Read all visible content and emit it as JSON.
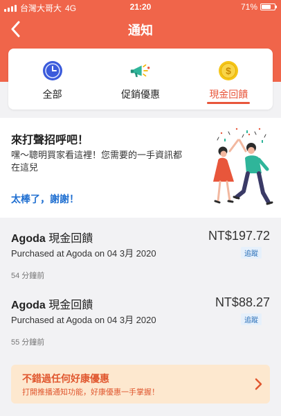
{
  "status_bar": {
    "carrier": "台灣大哥大",
    "network": "4G",
    "time": "21:20",
    "battery": "71%",
    "battery_level": 0.71
  },
  "header": {
    "title": "通知",
    "back_icon": "chevron-left-icon"
  },
  "tabs": [
    {
      "label": "全部",
      "icon": "clock-icon",
      "active": false
    },
    {
      "label": "促銷優惠",
      "icon": "megaphone-icon",
      "active": false
    },
    {
      "label": "現金回饋",
      "icon": "dollar-coin-icon",
      "active": true
    }
  ],
  "welcome": {
    "title": "來打聲招呼吧！",
    "description": "嘿～聰明買家看這裡！您需要的一手資訊都在這兒",
    "link_label": "太棒了，謝謝！"
  },
  "notifications": [
    {
      "brand": "Agoda",
      "title_suffix": "現金回饋",
      "subtitle": "Purchased at Agoda on 04 3月 2020",
      "amount": "NT$197.72",
      "badge": "追蹤",
      "time": "54 分鐘前"
    },
    {
      "brand": "Agoda",
      "title_suffix": "現金回饋",
      "subtitle": "Purchased at Agoda on 04 3月 2020",
      "amount": "NT$88.27",
      "badge": "追蹤",
      "time": "55 分鐘前"
    }
  ],
  "promo": {
    "title": "不錯過任何好康優惠",
    "subtitle": "打開推播通知功能，好康優惠一手掌握！",
    "icon": "chevron-right-icon"
  },
  "colors": {
    "header": "#f0654a",
    "accent": "#e8563b",
    "link": "#1f6fd1",
    "promo_bg": "#fde8cf",
    "promo_text": "#e0572f"
  }
}
